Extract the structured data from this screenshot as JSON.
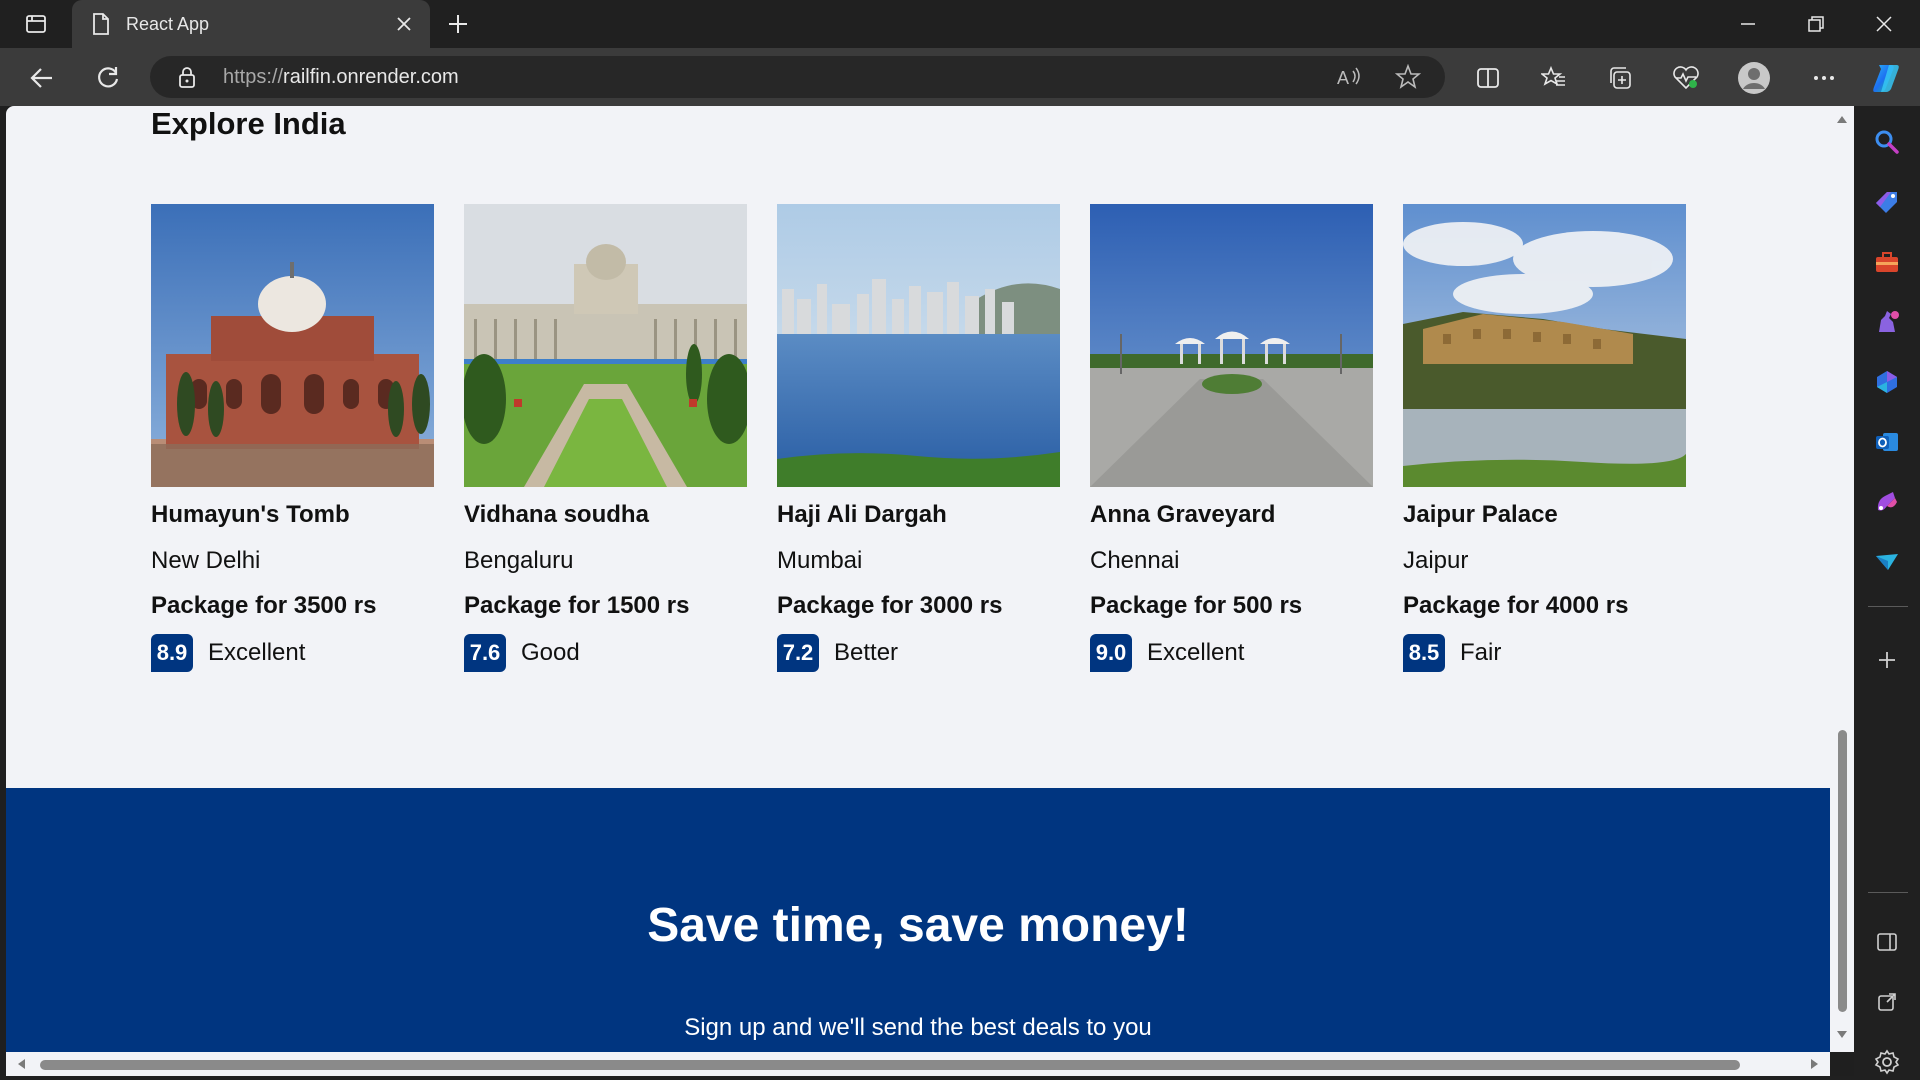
{
  "browser": {
    "tab_title": "React App",
    "url_protocol": "https://",
    "url_host": "railfin.onrender.com"
  },
  "page": {
    "section_title": "Explore India",
    "destinations": [
      {
        "name": "Humayun's Tomb",
        "city": "New Delhi",
        "package": "Package for 3500 rs",
        "score": "8.9",
        "rating": "Excellent"
      },
      {
        "name": "Vidhana soudha",
        "city": "Bengaluru",
        "package": "Package for 1500 rs",
        "score": "7.6",
        "rating": "Good"
      },
      {
        "name": "Haji Ali Dargah",
        "city": "Mumbai",
        "package": "Package for 3000 rs",
        "score": "7.2",
        "rating": "Better"
      },
      {
        "name": "Anna Graveyard",
        "city": "Chennai",
        "package": "Package for 500 rs",
        "score": "9.0",
        "rating": "Excellent"
      },
      {
        "name": "Jaipur Palace",
        "city": "Jaipur",
        "package": "Package for 4000 rs",
        "score": "8.5",
        "rating": "Fair"
      }
    ],
    "banner_title": "Save time, save money!",
    "banner_subtitle": "Sign up and we'll send the best deals to you"
  },
  "icons": {
    "sidebar": [
      "search-icon",
      "tag-icon",
      "briefcase-icon",
      "games-icon",
      "bing-icon",
      "outlook-icon",
      "designer-icon",
      "send-icon",
      "add-icon",
      "split-panel-icon",
      "external-link-icon",
      "settings-icon"
    ]
  },
  "colors": {
    "brand_blue": "#003580",
    "page_bg": "#f2f3f7"
  }
}
